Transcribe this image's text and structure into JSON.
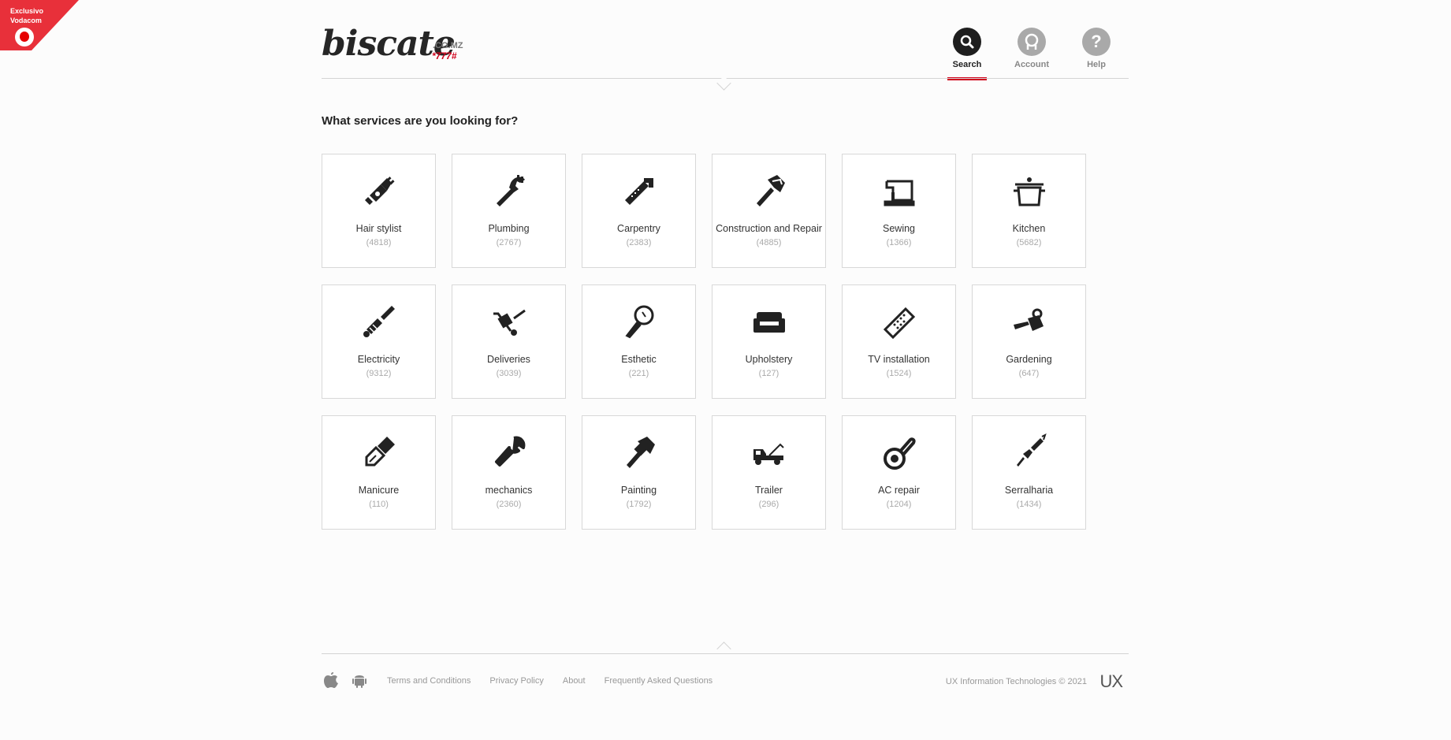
{
  "ribbon": {
    "line1": "Exclusivo",
    "line2": "Vodacom",
    "color": "#e8303a"
  },
  "header": {
    "logo": "biscate",
    "logo_tld": ".CO.MZ",
    "logo_code": "*777#",
    "nav": [
      {
        "label": "Search",
        "icon": "search-icon",
        "active": true
      },
      {
        "label": "Account",
        "icon": "user-icon",
        "active": false
      },
      {
        "label": "Help",
        "icon": "help-icon",
        "active": false
      }
    ]
  },
  "main": {
    "question": "What services are you looking for?",
    "services": [
      {
        "label": "Hair stylist",
        "count": "(4818)",
        "icon": "hair-clipper-icon"
      },
      {
        "label": "Plumbing",
        "count": "(2767)",
        "icon": "pipe-wrench-icon"
      },
      {
        "label": "Carpentry",
        "count": "(2383)",
        "icon": "saw-icon"
      },
      {
        "label": "Construction and Repair",
        "count": "(4885)",
        "icon": "hammer-icon"
      },
      {
        "label": "Sewing",
        "count": "(1366)",
        "icon": "sewing-machine-icon"
      },
      {
        "label": "Kitchen",
        "count": "(5682)",
        "icon": "cooking-pot-icon"
      },
      {
        "label": "Electricity",
        "count": "(9312)",
        "icon": "screwdriver-icon"
      },
      {
        "label": "Deliveries",
        "count": "(3039)",
        "icon": "hand-truck-icon"
      },
      {
        "label": "Esthetic",
        "count": "(221)",
        "icon": "mirror-icon"
      },
      {
        "label": "Upholstery",
        "count": "(127)",
        "icon": "sofa-icon"
      },
      {
        "label": "TV installation",
        "count": "(1524)",
        "icon": "remote-control-icon"
      },
      {
        "label": "Gardening",
        "count": "(647)",
        "icon": "watering-can-icon"
      },
      {
        "label": "Manicure",
        "count": "(110)",
        "icon": "nail-polish-icon"
      },
      {
        "label": "mechanics",
        "count": "(2360)",
        "icon": "wrench-icon"
      },
      {
        "label": "Painting",
        "count": "(1792)",
        "icon": "paint-brush-icon"
      },
      {
        "label": "Trailer",
        "count": "(296)",
        "icon": "tow-truck-icon"
      },
      {
        "label": "AC repair",
        "count": "(1204)",
        "icon": "thermometer-icon"
      },
      {
        "label": "Serralharia",
        "count": "(1434)",
        "icon": "welding-torch-icon"
      }
    ]
  },
  "footer": {
    "links": [
      "Terms and Conditions",
      "Privacy Policy",
      "About",
      "Frequently Asked Questions"
    ],
    "copyright": "UX Information Technologies © 2021",
    "brand": "UX"
  }
}
